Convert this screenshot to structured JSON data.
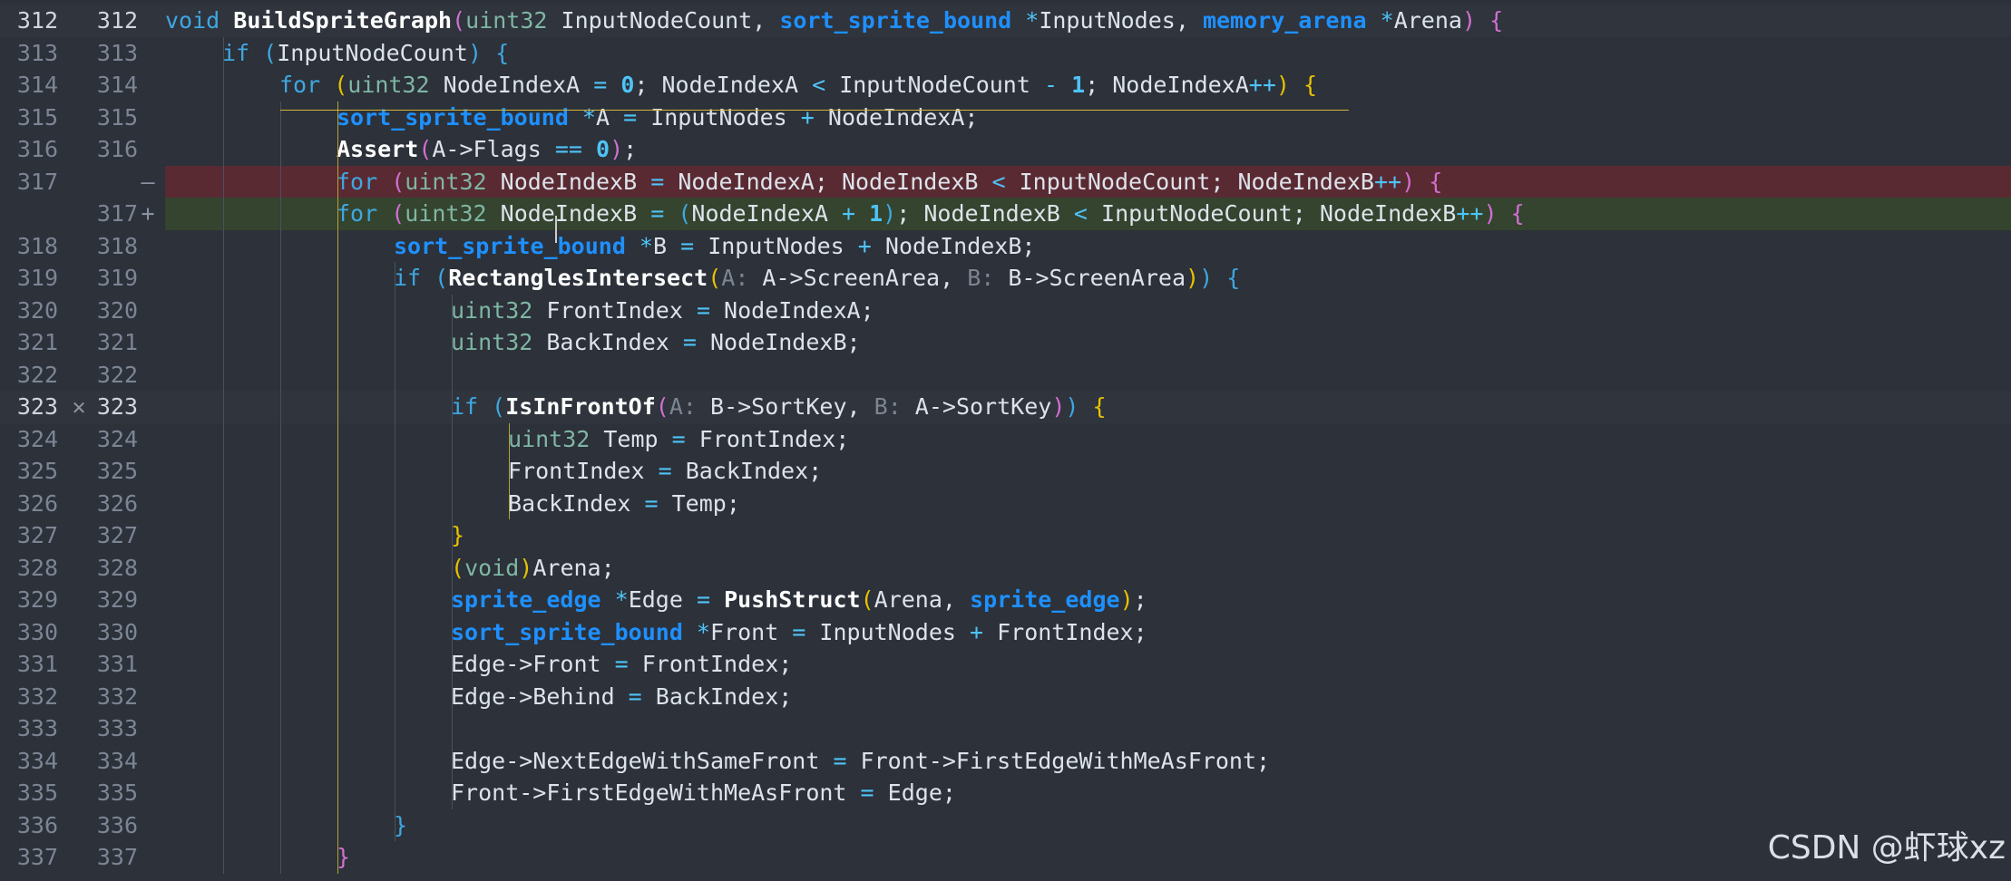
{
  "watermark": "CSDN @虾球xz",
  "colors": {
    "background": "#2c313a",
    "deleted_line": "#5a2a33",
    "added_line": "#34442f",
    "keyword": "#3fa7e0",
    "type": "#1e90ff"
  },
  "lines": [
    {
      "old": "312",
      "new": "312",
      "cur": true,
      "marker": "",
      "indent": 0,
      "tokens": [
        [
          "kw",
          "void "
        ],
        [
          "fn",
          "BuildSpriteGraph"
        ],
        [
          "p2",
          "("
        ],
        [
          "tyg",
          "uint32"
        ],
        [
          "pv",
          " InputNodeCount, "
        ],
        [
          "ty",
          "sort_sprite_bound"
        ],
        [
          "op",
          " *"
        ],
        [
          "pv",
          "InputNodes, "
        ],
        [
          "ty",
          "memory_arena"
        ],
        [
          "op",
          " *"
        ],
        [
          "pv",
          "Arena"
        ],
        [
          "p2",
          ")"
        ],
        [
          "pv",
          " "
        ],
        [
          "p2",
          "{"
        ]
      ]
    },
    {
      "old": "313",
      "new": "313",
      "indent": 1,
      "tokens": [
        [
          "kw",
          "if "
        ],
        [
          "p3",
          "("
        ],
        [
          "pv",
          "InputNodeCount"
        ],
        [
          "p3",
          ")"
        ],
        [
          "pv",
          " "
        ],
        [
          "p3",
          "{"
        ]
      ]
    },
    {
      "old": "314",
      "new": "314",
      "indent": 2,
      "tokens": [
        [
          "kw",
          "for "
        ],
        [
          "p1",
          "("
        ],
        [
          "tyg",
          "uint32"
        ],
        [
          "pv",
          " NodeIndexA "
        ],
        [
          "op",
          "="
        ],
        [
          "pv",
          " "
        ],
        [
          "num",
          "0"
        ],
        [
          "pv",
          "; NodeIndexA "
        ],
        [
          "op",
          "<"
        ],
        [
          "pv",
          " InputNodeCount "
        ],
        [
          "op",
          "-"
        ],
        [
          "pv",
          " "
        ],
        [
          "num",
          "1"
        ],
        [
          "pv",
          "; NodeIndexA"
        ],
        [
          "op",
          "++"
        ],
        [
          "p1",
          ")"
        ],
        [
          "pv",
          " "
        ],
        [
          "p1",
          "{"
        ]
      ]
    },
    {
      "old": "315",
      "new": "315",
      "indent": 3,
      "tokens": [
        [
          "ty",
          "sort_sprite_bound"
        ],
        [
          "op",
          " *"
        ],
        [
          "pv",
          "A "
        ],
        [
          "op",
          "="
        ],
        [
          "pv",
          " InputNodes "
        ],
        [
          "op",
          "+"
        ],
        [
          "pv",
          " NodeIndexA;"
        ]
      ]
    },
    {
      "old": "316",
      "new": "316",
      "indent": 3,
      "tokens": [
        [
          "fn",
          "Assert"
        ],
        [
          "p2",
          "("
        ],
        [
          "pv",
          "A->Flags "
        ],
        [
          "op",
          "=="
        ],
        [
          "pv",
          " "
        ],
        [
          "num",
          "0"
        ],
        [
          "p2",
          ")"
        ],
        [
          "pv",
          ";"
        ]
      ]
    },
    {
      "old": "317",
      "new": "",
      "del": true,
      "marker": "—",
      "indent": 3,
      "tokens": [
        [
          "kw",
          "for "
        ],
        [
          "p2",
          "("
        ],
        [
          "tyg",
          "uint32"
        ],
        [
          "pv",
          " NodeIndexB "
        ],
        [
          "op",
          "="
        ],
        [
          "pv",
          " NodeIndexA; NodeIndexB "
        ],
        [
          "op",
          "<"
        ],
        [
          "pv",
          " InputNodeCount; NodeIndexB"
        ],
        [
          "op",
          "++"
        ],
        [
          "p2",
          ")"
        ],
        [
          "pv",
          " "
        ],
        [
          "p2",
          "{"
        ]
      ]
    },
    {
      "old": "",
      "new": "317",
      "add": true,
      "marker": "+",
      "indent": 3,
      "tokens": [
        [
          "kw",
          "for "
        ],
        [
          "p2",
          "("
        ],
        [
          "tyg",
          "uint32"
        ],
        [
          "pv",
          " NodeIndexB "
        ],
        [
          "op",
          "="
        ],
        [
          "pv",
          " "
        ],
        [
          "p3",
          "("
        ],
        [
          "pv",
          "NodeIndexA "
        ],
        [
          "op",
          "+"
        ],
        [
          "pv",
          " "
        ],
        [
          "num",
          "1"
        ],
        [
          "p3",
          ")"
        ],
        [
          "pv",
          "; NodeIndexB "
        ],
        [
          "op",
          "<"
        ],
        [
          "pv",
          " InputNodeCount; NodeIndexB"
        ],
        [
          "op",
          "++"
        ],
        [
          "p2",
          ")"
        ],
        [
          "pv",
          " "
        ],
        [
          "p2",
          "{"
        ]
      ]
    },
    {
      "old": "318",
      "new": "318",
      "indent": 4,
      "tokens": [
        [
          "ty",
          "sort_sprite_bound"
        ],
        [
          "op",
          " *"
        ],
        [
          "pv",
          "B "
        ],
        [
          "op",
          "="
        ],
        [
          "pv",
          " InputNodes "
        ],
        [
          "op",
          "+"
        ],
        [
          "pv",
          " NodeIndexB;"
        ]
      ]
    },
    {
      "old": "319",
      "new": "319",
      "indent": 4,
      "tokens": [
        [
          "kw",
          "if "
        ],
        [
          "p3",
          "("
        ],
        [
          "fn",
          "RectanglesIntersect"
        ],
        [
          "p1",
          "("
        ],
        [
          "hint",
          "A: "
        ],
        [
          "pv",
          "A->ScreenArea, "
        ],
        [
          "hint",
          "B: "
        ],
        [
          "pv",
          "B->ScreenArea"
        ],
        [
          "p1",
          ")"
        ],
        [
          "p3",
          ")"
        ],
        [
          "pv",
          " "
        ],
        [
          "p3",
          "{"
        ]
      ]
    },
    {
      "old": "320",
      "new": "320",
      "indent": 5,
      "tokens": [
        [
          "tyg",
          "uint32"
        ],
        [
          "pv",
          " FrontIndex "
        ],
        [
          "op",
          "="
        ],
        [
          "pv",
          " NodeIndexA;"
        ]
      ]
    },
    {
      "old": "321",
      "new": "321",
      "indent": 5,
      "tokens": [
        [
          "tyg",
          "uint32"
        ],
        [
          "pv",
          " BackIndex "
        ],
        [
          "op",
          "="
        ],
        [
          "pv",
          " NodeIndexB;"
        ]
      ]
    },
    {
      "old": "322",
      "new": "322",
      "indent": 5,
      "tokens": []
    },
    {
      "old": "323",
      "new": "323",
      "marker": "✕",
      "markerX": true,
      "cur": true,
      "indent": 5,
      "tokens": [
        [
          "kw",
          "if "
        ],
        [
          "p3",
          "("
        ],
        [
          "fn",
          "IsInFrontOf"
        ],
        [
          "p2",
          "("
        ],
        [
          "hint",
          "A: "
        ],
        [
          "pv",
          "B->SortKey, "
        ],
        [
          "hint",
          "B: "
        ],
        [
          "pv",
          "A->SortKey"
        ],
        [
          "p2",
          ")"
        ],
        [
          "p3",
          ")"
        ],
        [
          "pv",
          " "
        ],
        [
          "p1",
          "{"
        ]
      ]
    },
    {
      "old": "324",
      "new": "324",
      "indent": 6,
      "tokens": [
        [
          "tyg",
          "uint32"
        ],
        [
          "pv",
          " Temp "
        ],
        [
          "op",
          "="
        ],
        [
          "pv",
          " FrontIndex;"
        ]
      ]
    },
    {
      "old": "325",
      "new": "325",
      "indent": 6,
      "tokens": [
        [
          "pv",
          "FrontIndex "
        ],
        [
          "op",
          "="
        ],
        [
          "pv",
          " BackIndex;"
        ]
      ]
    },
    {
      "old": "326",
      "new": "326",
      "indent": 6,
      "tokens": [
        [
          "pv",
          "BackIndex "
        ],
        [
          "op",
          "="
        ],
        [
          "pv",
          " Temp;"
        ]
      ]
    },
    {
      "old": "327",
      "new": "327",
      "indent": 5,
      "tokens": [
        [
          "p1",
          "}"
        ]
      ]
    },
    {
      "old": "328",
      "new": "328",
      "indent": 5,
      "tokens": [
        [
          "p1",
          "("
        ],
        [
          "tyg",
          "void"
        ],
        [
          "p1",
          ")"
        ],
        [
          "pv",
          "Arena;"
        ]
      ]
    },
    {
      "old": "329",
      "new": "329",
      "indent": 5,
      "tokens": [
        [
          "ty",
          "sprite_edge"
        ],
        [
          "op",
          " *"
        ],
        [
          "pv",
          "Edge "
        ],
        [
          "op",
          "="
        ],
        [
          "pv",
          " "
        ],
        [
          "fn",
          "PushStruct"
        ],
        [
          "p1",
          "("
        ],
        [
          "pv",
          "Arena, "
        ],
        [
          "ty",
          "sprite_edge"
        ],
        [
          "p1",
          ")"
        ],
        [
          "pv",
          ";"
        ]
      ]
    },
    {
      "old": "330",
      "new": "330",
      "indent": 5,
      "tokens": [
        [
          "ty",
          "sort_sprite_bound"
        ],
        [
          "op",
          " *"
        ],
        [
          "pv",
          "Front "
        ],
        [
          "op",
          "="
        ],
        [
          "pv",
          " InputNodes "
        ],
        [
          "op",
          "+"
        ],
        [
          "pv",
          " FrontIndex;"
        ]
      ]
    },
    {
      "old": "331",
      "new": "331",
      "indent": 5,
      "tokens": [
        [
          "pv",
          "Edge->Front "
        ],
        [
          "op",
          "="
        ],
        [
          "pv",
          " FrontIndex;"
        ]
      ]
    },
    {
      "old": "332",
      "new": "332",
      "indent": 5,
      "tokens": [
        [
          "pv",
          "Edge->Behind "
        ],
        [
          "op",
          "="
        ],
        [
          "pv",
          " BackIndex;"
        ]
      ]
    },
    {
      "old": "333",
      "new": "333",
      "indent": 5,
      "tokens": []
    },
    {
      "old": "334",
      "new": "334",
      "indent": 5,
      "tokens": [
        [
          "pv",
          "Edge->NextEdgeWithSameFront "
        ],
        [
          "op",
          "="
        ],
        [
          "pv",
          " Front->FirstEdgeWithMeAsFront;"
        ]
      ]
    },
    {
      "old": "335",
      "new": "335",
      "indent": 5,
      "tokens": [
        [
          "pv",
          "Front->FirstEdgeWithMeAsFront "
        ],
        [
          "op",
          "="
        ],
        [
          "pv",
          " Edge;"
        ]
      ]
    },
    {
      "old": "336",
      "new": "336",
      "indent": 4,
      "tokens": [
        [
          "p3",
          "}"
        ]
      ]
    },
    {
      "old": "337",
      "new": "337",
      "indent": 3,
      "tokens": [
        [
          "p2",
          "}"
        ]
      ]
    }
  ]
}
